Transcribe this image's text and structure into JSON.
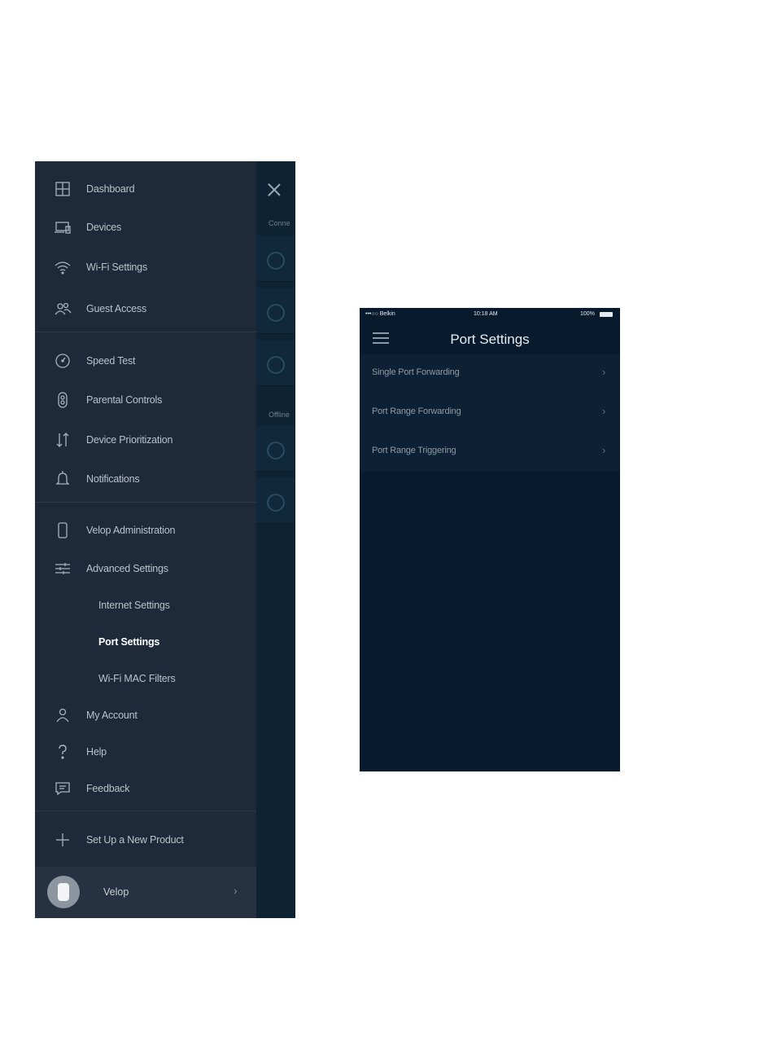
{
  "drawer": {
    "nav_items": [
      {
        "label": "Dashboard",
        "icon": "dashboard-icon"
      },
      {
        "label": "Devices",
        "icon": "devices-icon"
      },
      {
        "label": "Wi-Fi Settings",
        "icon": "wifi-icon"
      },
      {
        "label": "Guest Access",
        "icon": "guest-access-icon"
      },
      {
        "label": "Speed Test",
        "icon": "speed-test-icon"
      },
      {
        "label": "Parental Controls",
        "icon": "parental-controls-icon"
      },
      {
        "label": "Device Prioritization",
        "icon": "prioritization-icon"
      },
      {
        "label": "Notifications",
        "icon": "bell-icon"
      },
      {
        "label": "Velop Administration",
        "icon": "node-icon"
      },
      {
        "label": "Advanced Settings",
        "icon": "sliders-icon"
      },
      {
        "label": "Internet Settings"
      },
      {
        "label": "Port Settings",
        "active": true
      },
      {
        "label": "Wi-Fi MAC Filters"
      },
      {
        "label": "My Account",
        "icon": "person-icon"
      },
      {
        "label": "Help",
        "icon": "help-icon"
      },
      {
        "label": "Feedback",
        "icon": "feedback-icon"
      },
      {
        "label": "Set Up a New Product",
        "icon": "plus-icon"
      }
    ],
    "footer": {
      "label": "Velop"
    }
  },
  "background_screen": {
    "section_connected": "Conne",
    "section_offline": "Offline"
  },
  "port_settings": {
    "status_bar": {
      "carrier": "•••○○ Belkin",
      "time": "10:18 AM",
      "battery": "100%"
    },
    "title": "Port Settings",
    "items": [
      {
        "label": "Single Port Forwarding"
      },
      {
        "label": "Port Range Forwarding"
      },
      {
        "label": "Port Range Triggering"
      }
    ]
  },
  "colors": {
    "drawer_bg": "#1e2a39",
    "screen_bg": "#081a2e",
    "list_row_bg": "#0d2034"
  }
}
